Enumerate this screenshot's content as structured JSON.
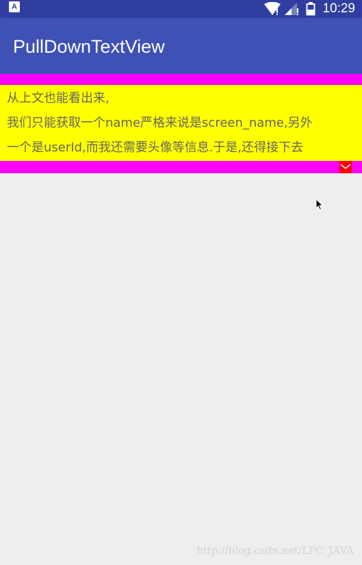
{
  "status_bar": {
    "app_icon_letter": "A",
    "time": "10:29"
  },
  "app_bar": {
    "title": "PullDownTextView"
  },
  "pulldown": {
    "lines": [
      "从上文也能看出来,",
      "我们只能获取一个name严格来说是screen_name,另外",
      "一个是userId,而我还需要头像等信息.于是,还得接下去"
    ],
    "toggle_icon": "chevron-down-icon",
    "colors": {
      "border": "#ff00ff",
      "text_background": "#ffff00",
      "toggle": "#ff0000",
      "text": "#666666"
    }
  },
  "watermark": "http://blog.csdn.net/LPC_JAVA",
  "colors": {
    "status_bar": "#303f9f",
    "app_bar": "#3f51b5",
    "background": "#eeeeee"
  }
}
